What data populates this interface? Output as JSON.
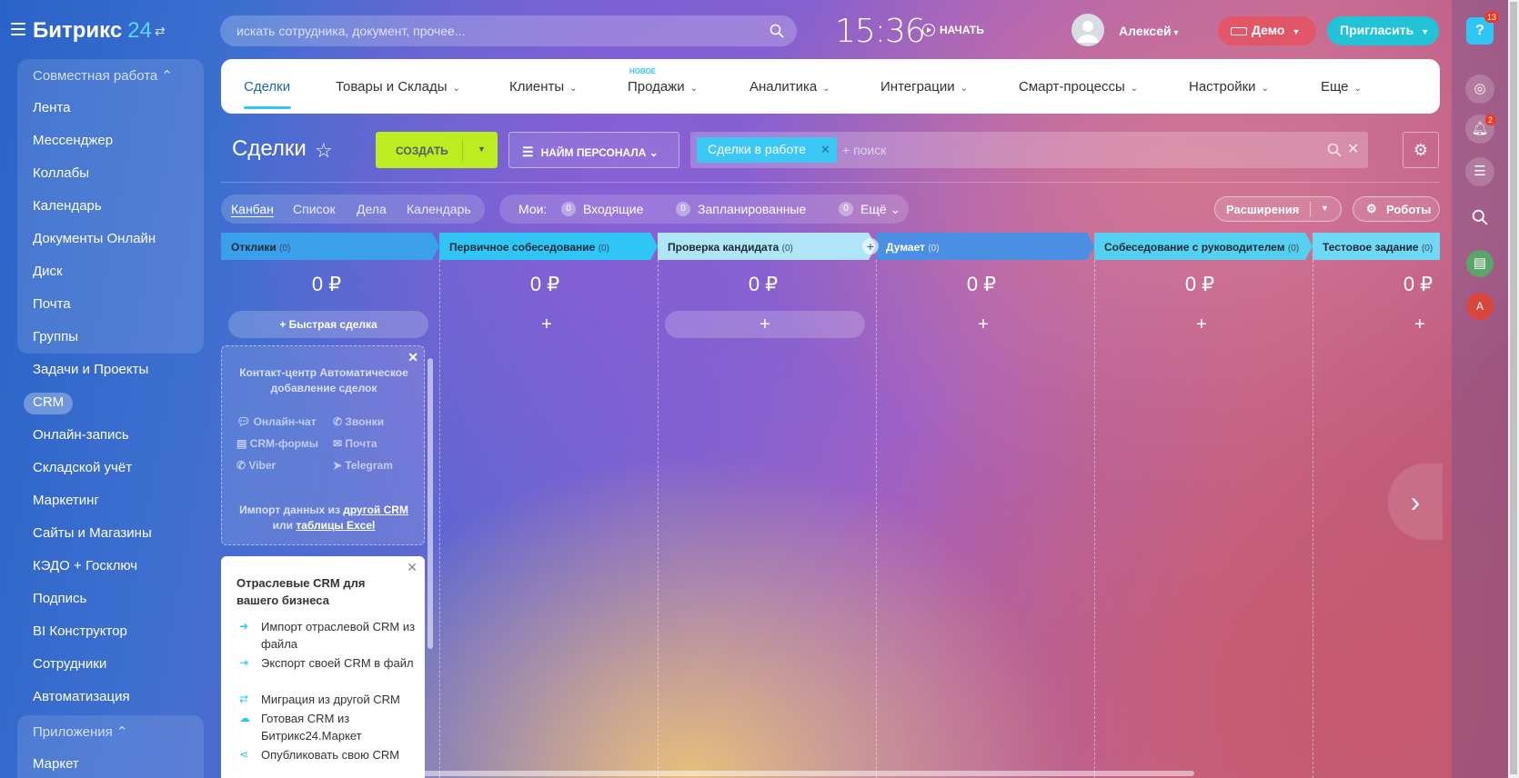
{
  "header": {
    "logo_text": "Битрикс",
    "logo_num": "24",
    "search_placeholder": "искать сотрудника, документ, прочее...",
    "clock": "15:36",
    "start_label": "НАЧАТЬ",
    "user_name": "Алексей",
    "demo_label": "Демо",
    "invite_label": "Пригласить"
  },
  "right_panel": {
    "help_badge": "13",
    "notif_badge": "2",
    "avatar_letter": "А"
  },
  "sidebar": {
    "group1_title": "Совместная работа",
    "group1_items": [
      "Лента",
      "Мессенджер",
      "Коллабы",
      "Календарь",
      "Документы Онлайн",
      "Диск",
      "Почта",
      "Группы"
    ],
    "items": [
      "Задачи и Проекты",
      "CRM",
      "Онлайн-запись",
      "Складской учёт",
      "Маркетинг",
      "Сайты и Магазины",
      "КЭДО + Госключ",
      "Подпись",
      "BI Конструктор",
      "Сотрудники",
      "Автоматизация"
    ],
    "group2_title": "Приложения",
    "group2_items": [
      "Маркет"
    ]
  },
  "nav": {
    "items": [
      "Сделки",
      "Товары и Склады",
      "Клиенты",
      "Продажи",
      "Аналитика",
      "Интеграции",
      "Смарт-процессы",
      "Настройки",
      "Еще"
    ],
    "new_label": "НОВОЕ"
  },
  "toolbar": {
    "title": "Сделки",
    "create_label": "СОЗДАТЬ",
    "hire_label": "НАЙМ ПЕРСОНАЛА",
    "filter_tag": "Сделки в работе",
    "filter_placeholder": "+ поиск"
  },
  "views": {
    "items": [
      "Канбан",
      "Список",
      "Дела",
      "Календарь"
    ],
    "mine_label": "Мои:",
    "incoming_count": "0",
    "incoming_label": "Входящие",
    "planned_count": "0",
    "planned_label": "Запланированные",
    "more_count": "0",
    "more_label": "Ещё",
    "extensions_label": "Расширения",
    "robots_label": "Роботы"
  },
  "kanban": {
    "columns": [
      {
        "title": "Отклики",
        "count": "(0)",
        "sum": "0 ₽",
        "color": "#3ba0ec"
      },
      {
        "title": "Первичное собеседование",
        "count": "(0)",
        "sum": "0 ₽",
        "color": "#2fc6f6"
      },
      {
        "title": "Проверка кандидата",
        "count": "(0)",
        "sum": "0 ₽",
        "color": "#aee6f7"
      },
      {
        "title": "Думает",
        "count": "(0)",
        "sum": "0 ₽",
        "color": "#4a8fe4"
      },
      {
        "title": "Собеседование с руководителем",
        "count": "(0)",
        "sum": "0 ₽",
        "color": "#55d0f0"
      },
      {
        "title": "Тестовое задание",
        "count": "(0)",
        "sum": "0 ₽",
        "color": "#6fd8f5"
      }
    ],
    "quick_deal": "Быстрая сделка",
    "contact_center": {
      "title": "Контакт-центр Автоматическое добавление сделок",
      "channels": [
        "Онлайн-чат",
        "Звонки",
        "CRM-формы",
        "Почта",
        "Viber",
        "Telegram"
      ],
      "import_prefix": "Импорт данных из",
      "import_link1": "другой CRM",
      "import_or": "или",
      "import_link2": "таблицы Excel"
    },
    "industry": {
      "title": "Отраслевые CRM для вашего бизнеса",
      "items": [
        "Импорт отраслевой CRM из файла",
        "Экспорт своей CRM в файл",
        "Миграция из другой CRM",
        "Готовая CRM из Битрикс24.Маркет",
        "Опубликовать свою CRM"
      ]
    }
  }
}
